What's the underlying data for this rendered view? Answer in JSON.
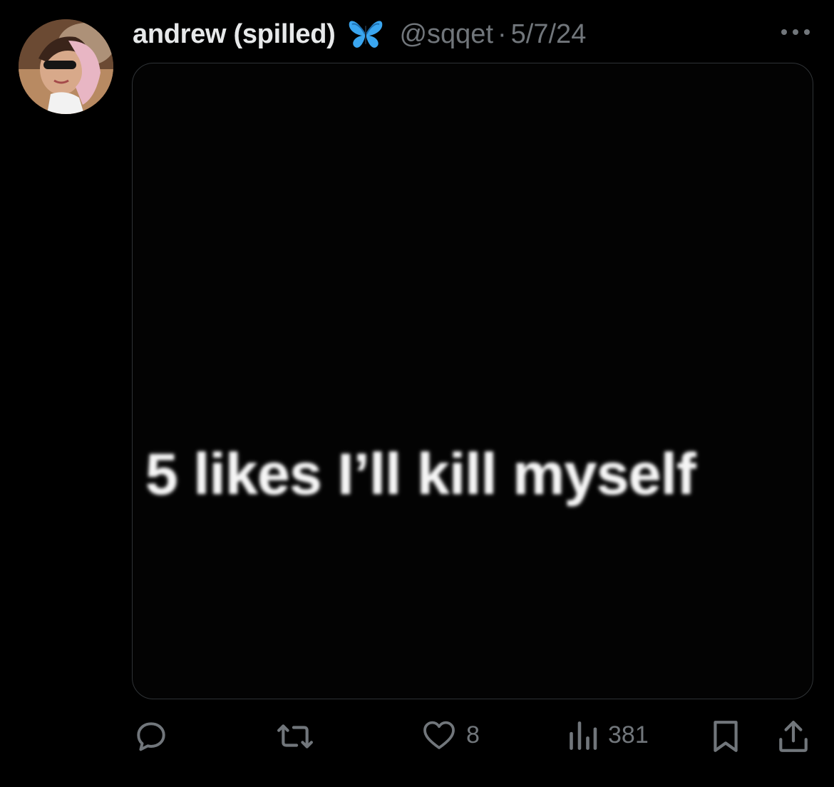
{
  "tweet": {
    "author": {
      "display_name": "andrew (spilled)",
      "badge_icon": "butterfly-emoji",
      "handle": "@sqqet",
      "avatar_icon": "profile-photo"
    },
    "separator": "·",
    "date": "5/7/24",
    "media": {
      "text": "5 likes I’ll kill myself",
      "background": "#000000"
    },
    "actions": {
      "reply_icon": "reply-icon",
      "repost_icon": "repost-icon",
      "like_icon": "heart-icon",
      "like_count": "8",
      "views_icon": "views-icon",
      "view_count": "381",
      "bookmark_icon": "bookmark-icon",
      "share_icon": "share-icon"
    },
    "more_icon": "more-icon"
  },
  "colors": {
    "background": "#000000",
    "primary_text": "#e7e9ea",
    "secondary_text": "#71767b",
    "border": "#2f3336",
    "butterfly": "#3aa6f0"
  }
}
